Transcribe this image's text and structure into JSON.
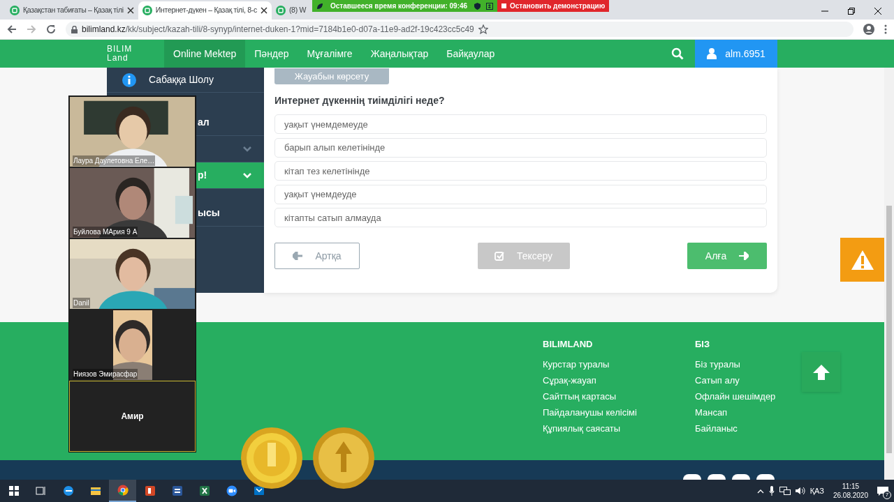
{
  "browser": {
    "tabs": [
      {
        "title": "Қазақстан табиғаты – Қазақ тілі",
        "selected": false
      },
      {
        "title": "Интернет-дүкен – Қазақ тілі, 8-с",
        "selected": true
      },
      {
        "title": "(8) W",
        "selected": false
      }
    ],
    "url_host": "bilimland.kz",
    "url_path": "/kk/subject/kazah-tili/8-synyp/internet-duken-1?mid=7184b1e0-d07a-11e9-ad2f-19c423cc5c49"
  },
  "meeting_bar": {
    "timer": "Оставшееся время конференции: 09:46",
    "stop_button": "Остановить демонстрацию"
  },
  "site_nav": {
    "logo": [
      "BILIM",
      "Land"
    ],
    "items": [
      {
        "label": "Online Mektep",
        "selected": true
      },
      {
        "label": "Пәндер",
        "selected": false
      },
      {
        "label": "Мұғалімге",
        "selected": false
      },
      {
        "label": "Жаңалықтар",
        "selected": false
      },
      {
        "label": "Байқаулар",
        "selected": false
      }
    ],
    "user": "alm.6951"
  },
  "sidebar": {
    "items": [
      {
        "kind": "info",
        "label": "Сабаққа Шолу",
        "selected": false
      },
      {
        "kind": "plain",
        "label": "ал",
        "selected": false
      },
      {
        "kind": "chevron",
        "selected": false
      },
      {
        "kind": "chevron",
        "label": "р!",
        "selected": true
      },
      {
        "kind": "plain",
        "label": "ысы",
        "selected": false
      }
    ]
  },
  "quiz": {
    "show_answer_button": "Жауабын көрсету",
    "question": "Интернет дүкеннің тиімділігі неде?",
    "options": [
      {
        "text": "уақыт үнемдемеуде",
        "selected": false
      },
      {
        "text": "барып алып келетінінде",
        "selected": false
      },
      {
        "text": "кітап тез келетінінде",
        "selected": false
      },
      {
        "text": "уақыт үнемдеуде",
        "selected": false
      },
      {
        "text": "кітапты сатып алмауда",
        "selected": false
      }
    ],
    "back_button": "Артқа",
    "check_button": {
      "label": "Тексеру",
      "disabled": true
    },
    "next_button": "Алға"
  },
  "video_panel": {
    "participants": [
      {
        "name": "Лаура Даулетовна Еле…",
        "video": true,
        "speaking": false
      },
      {
        "name": "Буйлова МАрия 9 А",
        "video": true,
        "speaking": false
      },
      {
        "name": "Danil",
        "video": true,
        "speaking": false
      },
      {
        "name": "Ниязов Эмирасфар",
        "video": true,
        "speaking": false
      },
      {
        "name": "Амир",
        "video": false,
        "speaking": true
      }
    ]
  },
  "footer": {
    "columns": [
      {
        "title": "BILIMLAND",
        "links": [
          "Курстар туралы",
          "Сұрақ-жауап",
          "Сайттың картасы",
          "Пайдаланушы келісімі",
          "Құпиялық саясаты"
        ]
      },
      {
        "title": "БІЗ",
        "links": [
          "Біз туралы",
          "Сатып алу",
          "Офлайн шешімдер",
          "Мансап",
          "Байланыс"
        ]
      }
    ]
  },
  "taskbar": {
    "language": "ҚАЗ",
    "time": "11:15",
    "date": "26.08.2020",
    "notifications": "7"
  }
}
